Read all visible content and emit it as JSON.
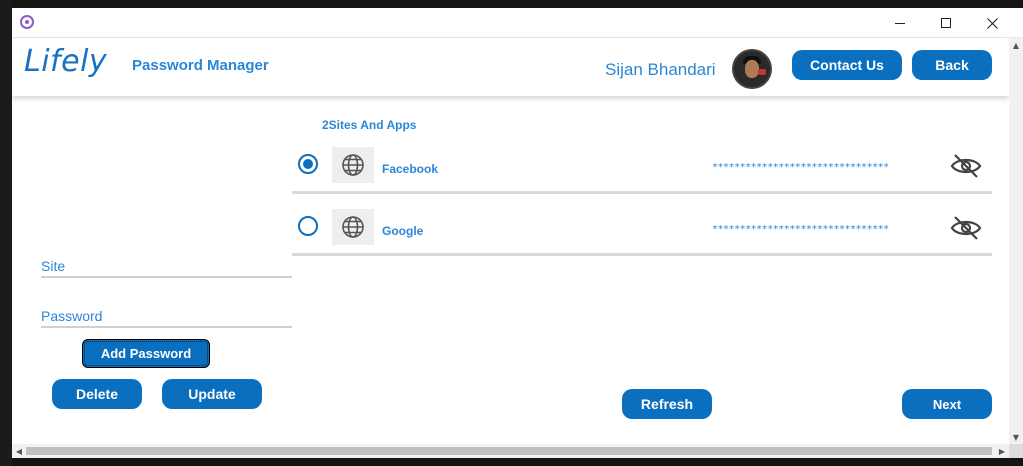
{
  "app": {
    "logo_text": "Lifely",
    "title": "Password Manager"
  },
  "user": {
    "name": "Sijan Bhandari"
  },
  "header_buttons": {
    "contact_label": "Contact Us",
    "back_label": "Back"
  },
  "list": {
    "heading": "2Sites And Apps",
    "items": [
      {
        "site": "Facebook",
        "masked_password": "********************************",
        "selected": true
      },
      {
        "site": "Google",
        "masked_password": "********************************",
        "selected": false
      }
    ]
  },
  "form": {
    "site_label": "Site",
    "password_label": "Password",
    "add_label": "Add Password",
    "delete_label": "Delete",
    "update_label": "Update"
  },
  "footer": {
    "refresh_label": "Refresh",
    "next_label": "Next"
  },
  "colors": {
    "accent": "#0b6fc0",
    "text_accent": "#2c86d6"
  }
}
